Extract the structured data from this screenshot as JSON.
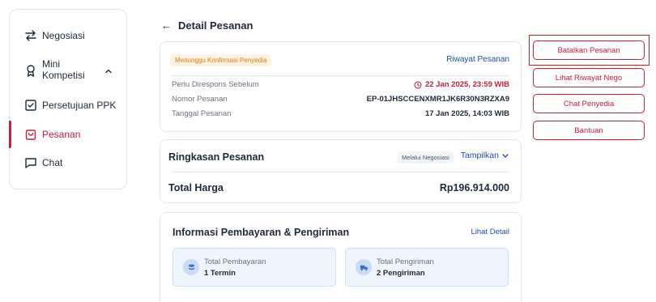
{
  "sidebar": {
    "items": [
      {
        "label": "Negosiasi",
        "icon": "swap-arrows-icon"
      },
      {
        "label": "Mini\nKompetisi",
        "icon": "award-ribbon-icon"
      },
      {
        "label": "Persetujuan PPK",
        "icon": "checkbox-icon"
      },
      {
        "label": "Pesanan",
        "icon": "shopping-bag-icon"
      },
      {
        "label": "Chat",
        "icon": "chat-bubble-icon"
      }
    ],
    "active_index": 3
  },
  "header": {
    "title": "Detail Pesanan"
  },
  "order_info": {
    "status": "Menunggu Konfirmasi Penyedia",
    "history_link": "Riwayat Pesanan",
    "rows": [
      {
        "label": "Perlu Direspons Sebelum",
        "value": "22 Jan 2025, 23:59 WIB"
      },
      {
        "label": "Nomor Pesanan",
        "value": "EP-01JHSCCENXMR1JK6R30N3RZXA9"
      },
      {
        "label": "Tanggal Pesanan",
        "value": "17 Jan 2025, 14:03 WIB"
      }
    ]
  },
  "summary": {
    "title": "Ringkasan Pesanan",
    "via": "Melalui Negosiasi",
    "expand_link": "Tampilkan",
    "total_label": "Total Harga",
    "total_value": "Rp196.914.000"
  },
  "payment": {
    "title": "Informasi Pembayaran & Pengiriman",
    "detail_link": "Lihat Detail",
    "boxes": [
      {
        "label": "Total Pembayaran",
        "value": "1 Termin"
      },
      {
        "label": "Total Pengiriman",
        "value": "2 Pengiriman"
      }
    ]
  },
  "actions": {
    "cancel": "Batalkan Pesanan",
    "nego_history": "Lihat Riwayat Nego",
    "chat": "Chat Penyedia",
    "help": "Bantuan"
  },
  "colors": {
    "accent": "#c4203a",
    "link": "#1e4bb8",
    "status_orange": "#e07b10"
  }
}
